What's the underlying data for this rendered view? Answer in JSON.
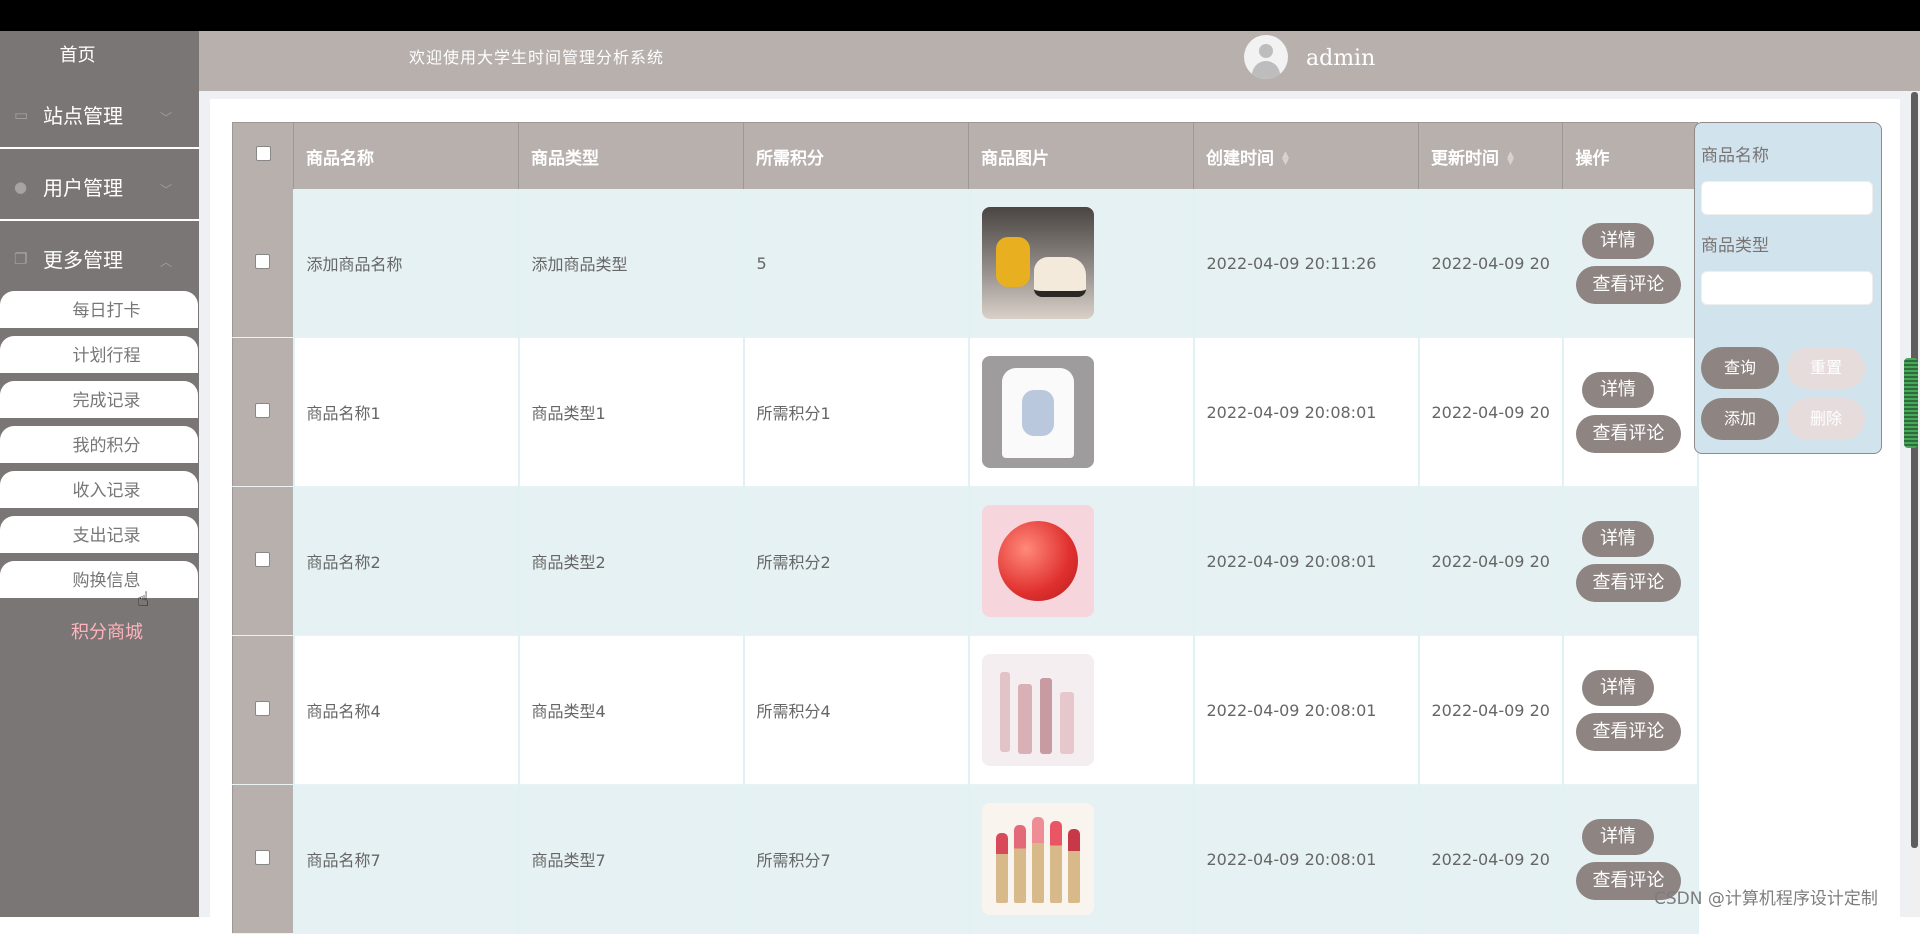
{
  "sidebar": {
    "home": "首页",
    "groups": [
      {
        "label": "站点管理"
      },
      {
        "label": "用户管理"
      },
      {
        "label": "更多管理"
      }
    ],
    "sub_items": [
      "每日打卡",
      "计划行程",
      "完成记录",
      "我的积分",
      "收入记录",
      "支出记录",
      "购换信息"
    ],
    "active_item": "积分商城"
  },
  "header": {
    "welcome": "欢迎使用大学生时间管理分析系统",
    "username": "admin"
  },
  "table": {
    "columns": [
      "商品名称",
      "商品类型",
      "所需积分",
      "商品图片",
      "创建时间",
      "更新时间",
      "操作"
    ],
    "rows": [
      {
        "name": "添加商品名称",
        "type": "添加商品类型",
        "points": "5",
        "image": "pikachu-sneaker-photo",
        "created": "2022-04-09 20:11:26",
        "updated": "2022-04-09 20"
      },
      {
        "name": "商品名称1",
        "type": "商品类型1",
        "points": "所需积分1",
        "image": "tshirt-photo",
        "created": "2022-04-09 20:08:01",
        "updated": "2022-04-09 20"
      },
      {
        "name": "商品名称2",
        "type": "商品类型2",
        "points": "所需积分2",
        "image": "apple-photo",
        "created": "2022-04-09 20:08:01",
        "updated": "2022-04-09 20"
      },
      {
        "name": "商品名称4",
        "type": "商品类型4",
        "points": "所需积分4",
        "image": "cosmetics-photo",
        "created": "2022-04-09 20:08:01",
        "updated": "2022-04-09 20"
      },
      {
        "name": "商品名称7",
        "type": "商品类型7",
        "points": "所需积分7",
        "image": "lipstick-photo",
        "created": "2022-04-09 20:08:01",
        "updated": "2022-04-09 20"
      }
    ],
    "actions": {
      "detail": "详情",
      "review": "查看评论"
    }
  },
  "search": {
    "name_label": "商品名称",
    "type_label": "商品类型",
    "query": "查询",
    "reset": "重置",
    "add": "添加",
    "delete": "删除"
  },
  "watermark": "CSDN @计算机程序设计定制",
  "colors": {
    "header": "#b8b0ad",
    "sidebar": "#7b7676",
    "button": "#8e8482",
    "active_menu": "#ffb3bc",
    "search_panel": "#d1e4ee"
  }
}
